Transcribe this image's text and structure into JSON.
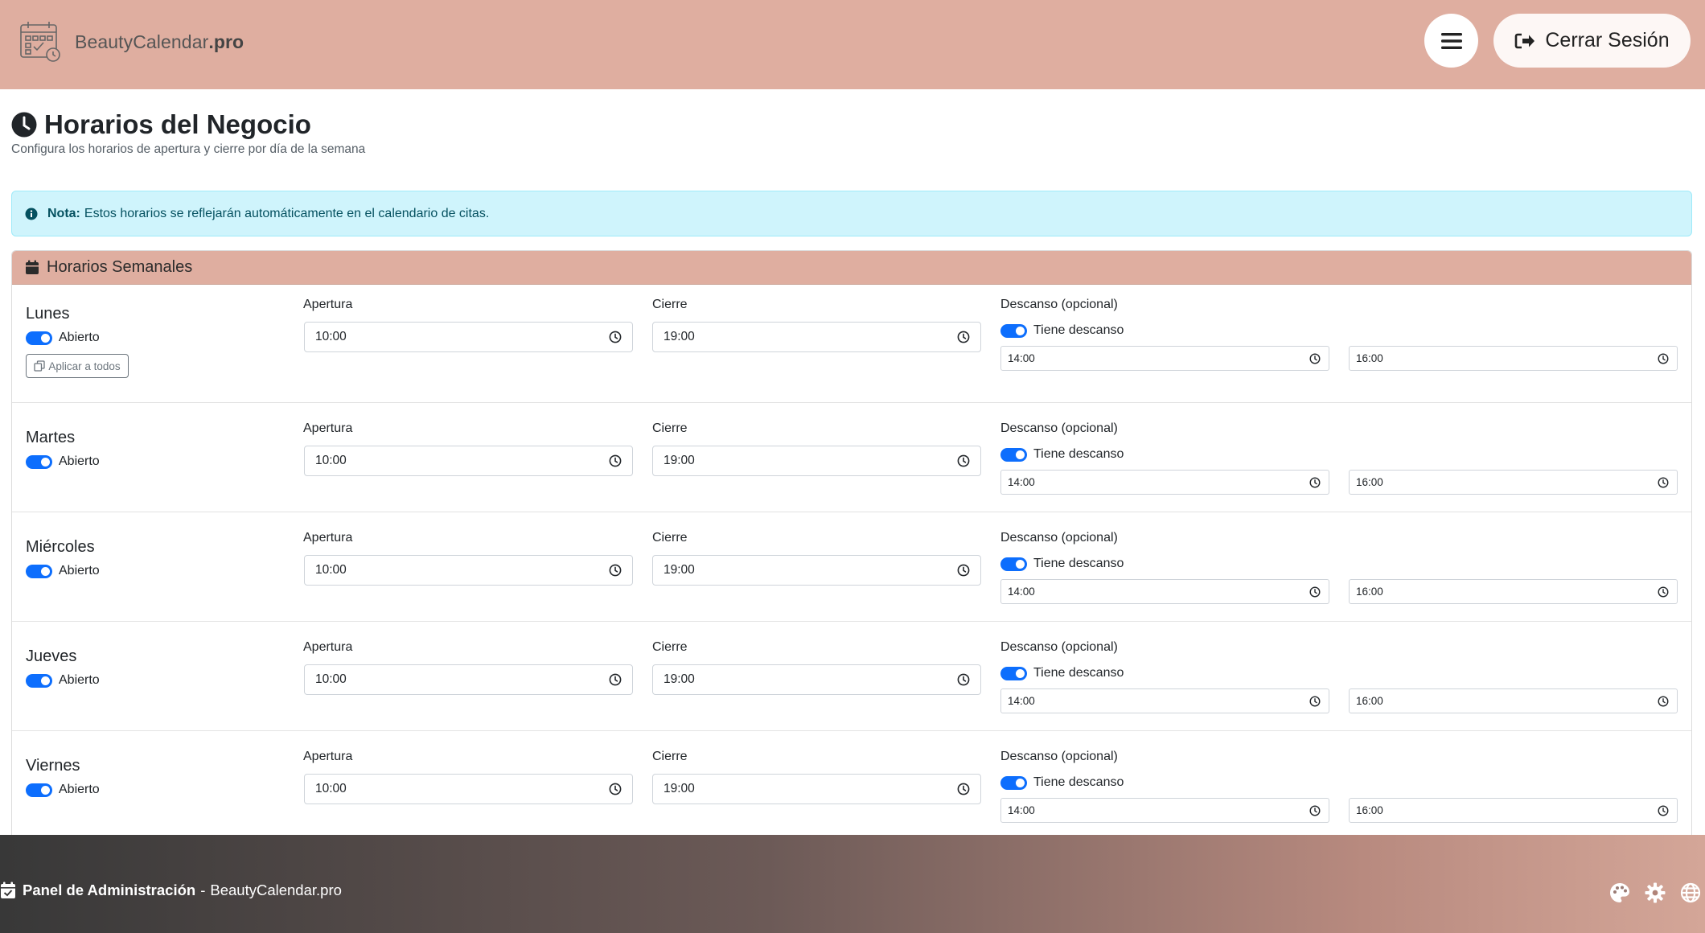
{
  "header": {
    "brand_name": "BeautyCalendar",
    "brand_suffix": ".pro",
    "logout_label": "Cerrar Sesión",
    "bg_color": "#dfaea0"
  },
  "page": {
    "title": "Horarios del Negocio",
    "subtitle": "Configura los horarios de apertura y cierre por día de la semana"
  },
  "alert": {
    "label": "Nota:",
    "text": "Estos horarios se reflejarán automáticamente en el calendario de citas."
  },
  "card": {
    "title": "Horarios Semanales"
  },
  "labels": {
    "open_status": "Abierto",
    "apply_all": "Aplicar a todos",
    "opening": "Apertura",
    "closing": "Cierre",
    "break_optional": "Descanso (opcional)",
    "has_break": "Tiene descanso"
  },
  "days": [
    {
      "name": "Lunes",
      "open": "10:00",
      "close": "19:00",
      "break_start": "14:00",
      "break_end": "16:00",
      "is_open": true,
      "has_break": true
    },
    {
      "name": "Martes",
      "open": "10:00",
      "close": "19:00",
      "break_start": "14:00",
      "break_end": "16:00",
      "is_open": true,
      "has_break": true
    },
    {
      "name": "Miércoles",
      "open": "10:00",
      "close": "19:00",
      "break_start": "14:00",
      "break_end": "16:00",
      "is_open": true,
      "has_break": true
    },
    {
      "name": "Jueves",
      "open": "10:00",
      "close": "19:00",
      "break_start": "14:00",
      "break_end": "16:00",
      "is_open": true,
      "has_break": true
    },
    {
      "name": "Viernes",
      "open": "10:00",
      "close": "19:00",
      "break_start": "14:00",
      "break_end": "16:00",
      "is_open": true,
      "has_break": true
    }
  ],
  "footer": {
    "panel_label": "Panel de Administración",
    "separator": "-",
    "site_name": "BeautyCalendar.pro",
    "icons": [
      "palette-icon",
      "gear-icon",
      "globe-icon"
    ]
  },
  "colors": {
    "accent": "#0d6efd",
    "alert_bg": "#cff4fc",
    "card_header": "#dfaea0"
  }
}
